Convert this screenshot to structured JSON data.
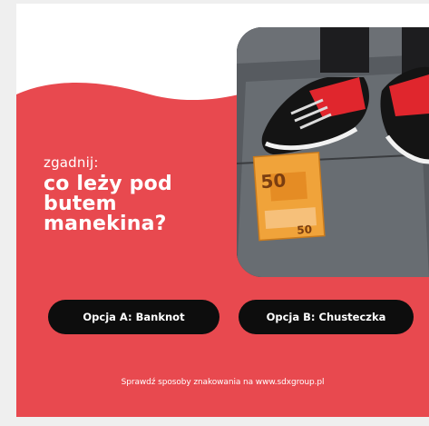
{
  "quiz": {
    "kicker": "zgadnij:",
    "question_lines": [
      "co leży pod",
      "butem",
      "manekina?"
    ]
  },
  "options": {
    "a_label": "Opcja A: Banknot",
    "b_label": "Opcja B: Chusteczka"
  },
  "footer": {
    "text": "Sprawdź sposoby znakowania na www.sdxgroup.pl"
  },
  "photo": {
    "banknote_value": "50"
  },
  "colors": {
    "accent_red": "#e8494f",
    "button_black": "#0d0d0d",
    "card_white": "#ffffff"
  }
}
